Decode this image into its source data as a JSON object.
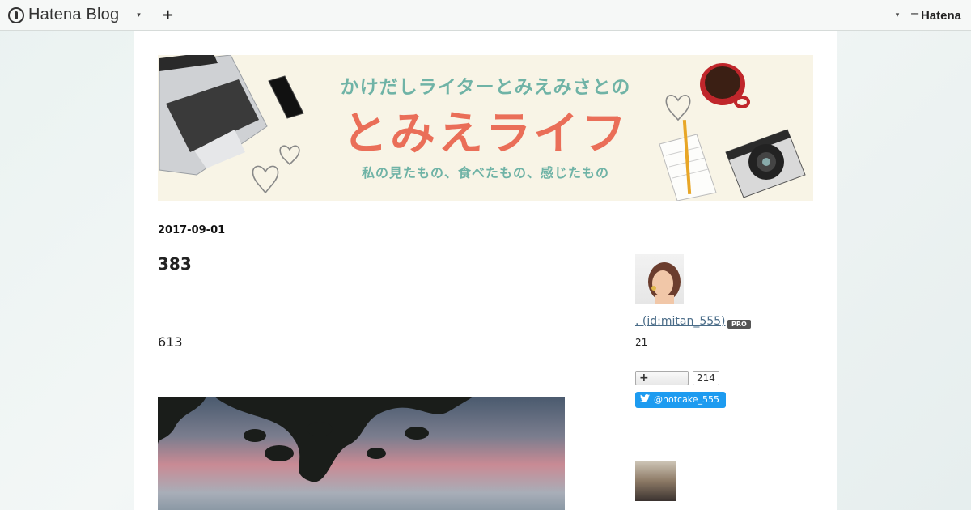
{
  "topbar": {
    "logo_label": "Hatena Blog",
    "menu_caret": "▾",
    "add_label": "+",
    "hatena_label": "Hatena"
  },
  "banner": {
    "subtitle": "かけだしライターとみえみさとの",
    "title": "とみえライフ",
    "tagline": "私の見たもの、食べたもの、感じたもの"
  },
  "entry": {
    "date": "2017-09-01",
    "title": "383",
    "text": "613"
  },
  "sidebar": {
    "profile_link": ". (id:mitan_555)",
    "pro_badge": "PRO",
    "count": "21",
    "follow_plus": "+",
    "follow_count": "214",
    "twitter_handle": "@hotcake_555"
  },
  "colors": {
    "accent_teal": "#6fb3a6",
    "accent_coral": "#ea6e58",
    "twitter_blue": "#1d9bf0",
    "link": "#4a6c88"
  }
}
